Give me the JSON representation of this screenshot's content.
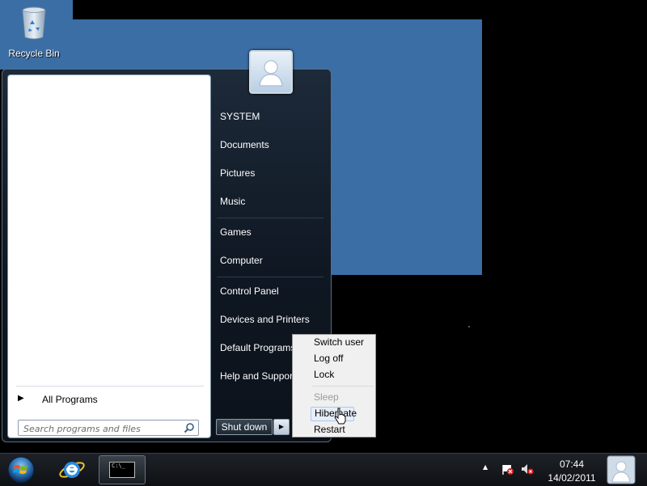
{
  "desktop": {
    "recycle_bin_label": "Recycle Bin",
    "recycle_bin_icon": "recycle-bin-icon",
    "background_color": "#000000",
    "window_color": "#3b6ea5"
  },
  "start_menu": {
    "all_programs_label": "All Programs",
    "search_placeholder": "Search programs and files",
    "user_picture_icon": "user-icon",
    "right_items": [
      {
        "label": "SYSTEM"
      },
      {
        "label": "Documents"
      },
      {
        "label": "Pictures"
      },
      {
        "label": "Music"
      },
      {
        "label": "Games"
      },
      {
        "label": "Computer"
      },
      {
        "label": "Control Panel"
      },
      {
        "label": "Devices and Printers"
      },
      {
        "label": "Default Programs"
      },
      {
        "label": "Help and Support"
      }
    ],
    "shutdown_label": "Shut down"
  },
  "shutdown_menu": {
    "items": [
      {
        "label": "Switch user",
        "enabled": true
      },
      {
        "label": "Log off",
        "enabled": true
      },
      {
        "label": "Lock",
        "enabled": true
      },
      {
        "label": "Sleep",
        "enabled": false
      },
      {
        "label": "Hibernate",
        "enabled": true,
        "hovered": true
      },
      {
        "label": "Restart",
        "enabled": true
      }
    ]
  },
  "taskbar": {
    "start_icon": "windows-orb-icon",
    "pinned": [
      {
        "icon": "internet-explorer-icon"
      },
      {
        "icon": "command-prompt-icon",
        "text": "C:\\_"
      }
    ],
    "clock_time": "07:44",
    "clock_date": "14/02/2011"
  }
}
